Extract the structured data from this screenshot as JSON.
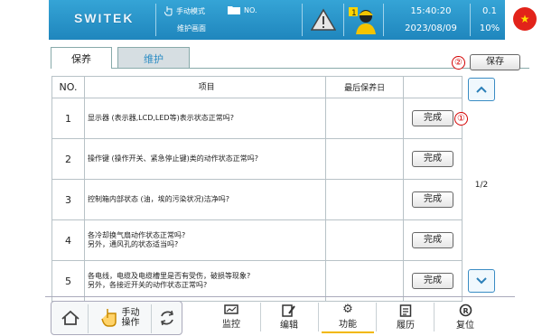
{
  "header": {
    "logo": "SWITEK",
    "mode_label": "手动模式",
    "screen_name": "维护画面",
    "file_label": "NO.",
    "user_badge": "1",
    "time": "15:40:20",
    "date": "2023/08/09",
    "value_top": "0.1",
    "value_bottom": "10%",
    "flag_symbol": "★"
  },
  "tabs": [
    {
      "label": "保养",
      "active": true
    },
    {
      "label": "维护",
      "active": false
    }
  ],
  "save_button": {
    "label": "保存",
    "marker": "②"
  },
  "table": {
    "headers": [
      "NO.",
      "项目",
      "最后保养日",
      ""
    ],
    "rows": [
      {
        "no": "1",
        "item": "显示器 (表示器,LCD,LED等)表示状态正常吗?",
        "last_date": "",
        "button": "完成"
      },
      {
        "no": "2",
        "item": "操作键 (操作开关、紧急停止键)类的动作状态正常吗?",
        "last_date": "",
        "button": "完成"
      },
      {
        "no": "3",
        "item": "控制箱内部状态 (油，埃的污染状况)洁净吗?",
        "last_date": "",
        "button": "完成"
      },
      {
        "no": "4",
        "item": "各冷却换气扇动作状态正常吗?\n另外，通风孔的状态适当吗?",
        "last_date": "",
        "button": "完成"
      },
      {
        "no": "5",
        "item": "各电线，电缆及电缆槽里是否有受伤，破损等现象?\n另外，各接近开关的动作状态正常吗?",
        "last_date": "",
        "button": "完成"
      }
    ],
    "row1_marker": "①"
  },
  "pager": {
    "page": "1/2"
  },
  "bottom_nav": {
    "manual_label": "手动\n操作",
    "items": [
      {
        "label": "监控",
        "icon": "monitor-icon"
      },
      {
        "label": "编辑",
        "icon": "edit-icon"
      },
      {
        "label": "功能",
        "icon": "gear-icon",
        "active": true
      },
      {
        "label": "履历",
        "icon": "history-icon"
      },
      {
        "label": "复位",
        "icon": "reset-icon"
      }
    ]
  },
  "colors": {
    "header": "#2593c8",
    "accent": "#f2b800",
    "marker": "#d40000"
  }
}
